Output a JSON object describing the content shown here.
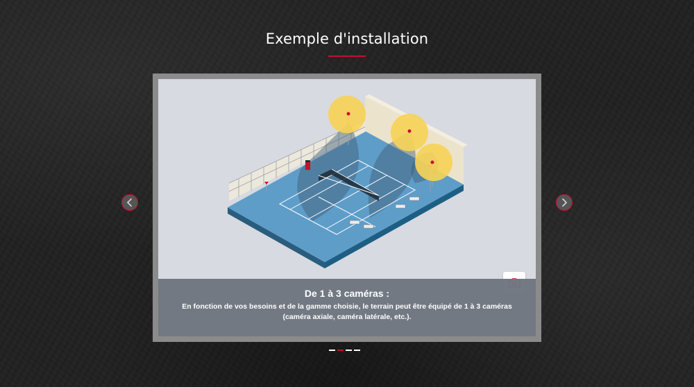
{
  "section": {
    "title": "Exemple d'installation"
  },
  "slide": {
    "caption_title": "De 1 à 3 caméras :",
    "caption_text": "En fonction de vos besoins et de la gamme choisie, le terrain peut être équipé de 1 à 3 caméras (caméra axiale, caméra latérale, etc.)."
  },
  "carousel": {
    "slide_count": 4,
    "active_index": 1
  },
  "icons": {
    "prev": "chevron-left-icon",
    "next": "chevron-right-icon",
    "photo": "camera-icon"
  },
  "colors": {
    "accent": "#c8102e",
    "court": "#5f9dc9",
    "court_edge": "#1d5f84",
    "camera_zone": "#f6d258",
    "slide_bg": "#d7dae0"
  }
}
